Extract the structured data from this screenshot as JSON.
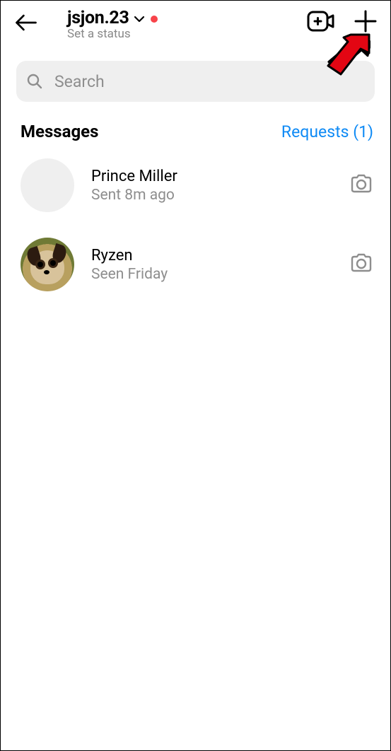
{
  "header": {
    "username": "jsjon.23",
    "status_prompt": "Set a status"
  },
  "search": {
    "placeholder": "Search"
  },
  "sections": {
    "messages_title": "Messages",
    "requests_label": "Requests (1)"
  },
  "conversations": [
    {
      "name": "Prince Miller",
      "subtitle": "Sent 8m ago"
    },
    {
      "name": "Ryzen",
      "subtitle": "Seen Friday"
    }
  ]
}
